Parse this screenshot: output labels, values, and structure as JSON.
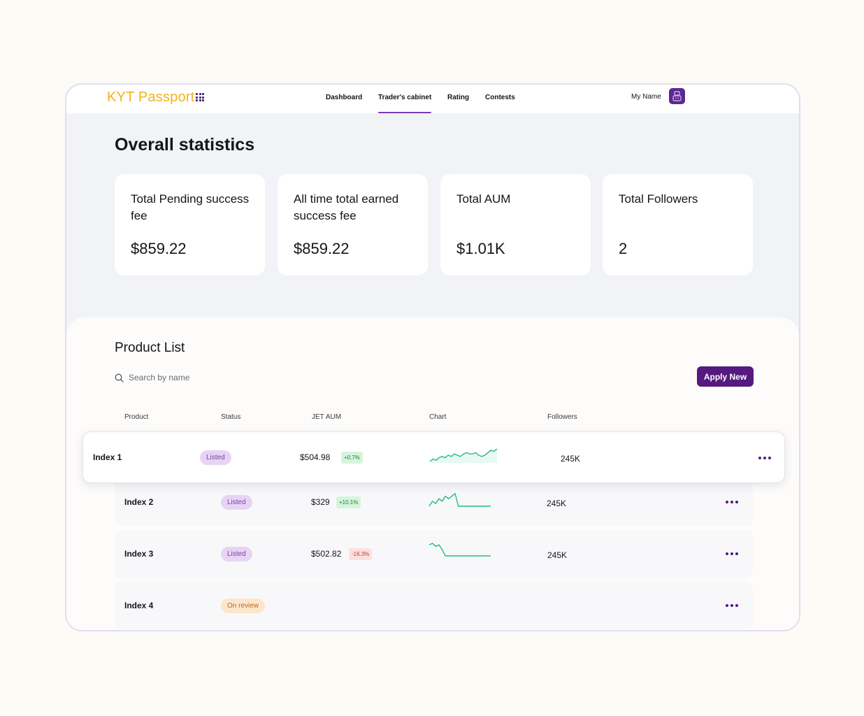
{
  "header": {
    "logo": "KYT Passport",
    "nav": [
      {
        "label": "Dashboard"
      },
      {
        "label": "Trader's cabinet",
        "active": true
      },
      {
        "label": "Rating"
      },
      {
        "label": "Contests"
      }
    ],
    "user_name": "My Name"
  },
  "stats": {
    "title": "Overall statistics",
    "cards": [
      {
        "label": "Total Pending success fee",
        "value": "$859.22"
      },
      {
        "label": "All time total earned success fee",
        "value": "$859.22"
      },
      {
        "label": "Total AUM",
        "value": "$1.01K"
      },
      {
        "label": "Total Followers",
        "value": "2"
      }
    ]
  },
  "products": {
    "title": "Product List",
    "search_placeholder": "Search by name",
    "apply_button": "Apply New",
    "columns": [
      "Product",
      "Status",
      "JET AUM",
      "Chart",
      "Followers"
    ],
    "rows": [
      {
        "name": "Index 1",
        "status": "Listed",
        "aum": "$504.98",
        "change": "+0.7%",
        "trend": "up",
        "followers": "245K",
        "chart": [
          3,
          5,
          4,
          6,
          7,
          6,
          8,
          7,
          9,
          8,
          7,
          9,
          10,
          9,
          9,
          10,
          8,
          7,
          8,
          10,
          12,
          11,
          13
        ]
      },
      {
        "name": "Index 2",
        "status": "Listed",
        "aum": "$329",
        "change": "+10.1%",
        "trend": "up",
        "followers": "245K",
        "chart": [
          3,
          5,
          4,
          6,
          5,
          7,
          6,
          7,
          8,
          3,
          3,
          3,
          3,
          3,
          3,
          3,
          3,
          3,
          3,
          3
        ]
      },
      {
        "name": "Index 3",
        "status": "Listed",
        "aum": "$502.82",
        "change": "-16.3%",
        "trend": "down",
        "followers": "245K",
        "chart": [
          11,
          12,
          10,
          11,
          8,
          4,
          4,
          4,
          4,
          4,
          4,
          4,
          4,
          4,
          4,
          4,
          4,
          4,
          4,
          4
        ]
      },
      {
        "name": "Index 4",
        "status": "On review"
      }
    ]
  },
  "colors": {
    "accent": "#55197f",
    "logo": "#f2b31b",
    "chart_line": "#1fbf7c",
    "listed_bg": "#e7d4f4",
    "review_bg": "#fde6cc"
  }
}
